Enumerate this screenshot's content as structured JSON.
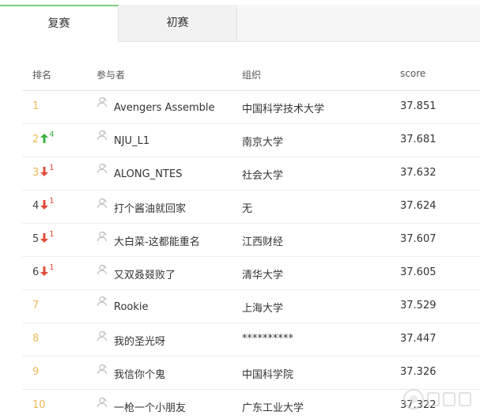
{
  "tabs": [
    {
      "label": "复赛",
      "active": true
    },
    {
      "label": "初赛",
      "active": false
    }
  ],
  "table": {
    "headers": {
      "rank": "排名",
      "participant": "参与者",
      "org": "组织",
      "score": "score"
    },
    "rows": [
      {
        "rank": "1",
        "trend": "",
        "delta": "",
        "name": "Avengers Assemble",
        "org": "中国科学技术大学",
        "score": "37.851"
      },
      {
        "rank": "2",
        "trend": "up",
        "delta": "4",
        "name": "NJU_L1",
        "org": "南京大学",
        "score": "37.681"
      },
      {
        "rank": "3",
        "trend": "down",
        "delta": "1",
        "name": "ALONG_NTES",
        "org": "社会大学",
        "score": "37.632"
      },
      {
        "rank": "4",
        "trend": "down",
        "delta": "1",
        "name": "打个酱油就回家",
        "org": "无",
        "score": "37.624"
      },
      {
        "rank": "5",
        "trend": "down",
        "delta": "1",
        "name": "大白菜-这都能重名",
        "org": "江西财经",
        "score": "37.607"
      },
      {
        "rank": "6",
        "trend": "down",
        "delta": "1",
        "name": "又双叒叕败了",
        "org": "清华大学",
        "score": "37.605"
      },
      {
        "rank": "7",
        "trend": "",
        "delta": "",
        "name": "Rookie",
        "org": "上海大学",
        "score": "37.529"
      },
      {
        "rank": "8",
        "trend": "",
        "delta": "",
        "name": "我的圣光呀",
        "org": "**********",
        "score": "37.447"
      },
      {
        "rank": "9",
        "trend": "",
        "delta": "",
        "name": "我信你个鬼",
        "org": "中国科学院",
        "score": "37.326"
      },
      {
        "rank": "10",
        "trend": "",
        "delta": "",
        "name": "一枪一个小朋友",
        "org": "广东工业大学",
        "score": "37.322"
      }
    ]
  },
  "icons": {
    "participant": "user-icon",
    "up": "arrow-up-icon",
    "down": "arrow-down-icon"
  },
  "colors": {
    "rank_top": "#f0b85a",
    "up": "#3cb043",
    "down": "#e04b3a",
    "tab_accent": "#7ecf7e"
  }
}
